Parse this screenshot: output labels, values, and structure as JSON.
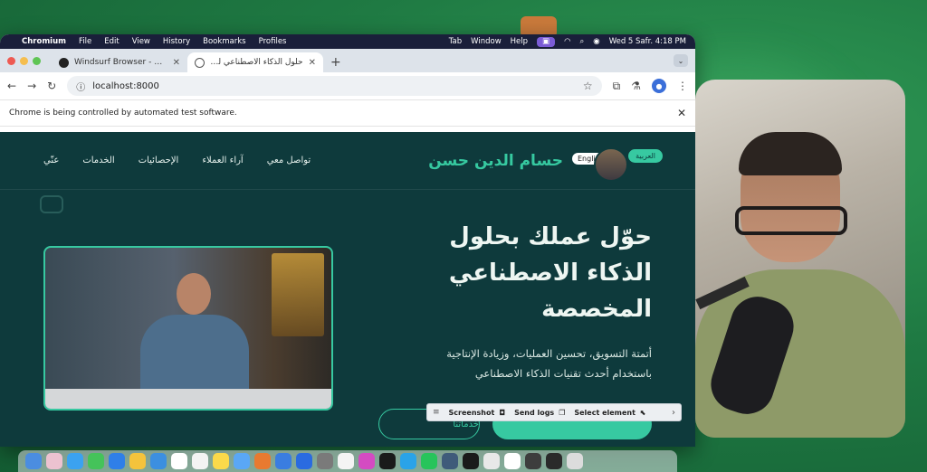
{
  "menubar": {
    "app": "Chromium",
    "items": [
      "File",
      "Edit",
      "View",
      "History",
      "Bookmarks",
      "Profiles"
    ],
    "right_items": [
      "Tab",
      "Window",
      "Help"
    ],
    "clock": "Wed 5 Safr.  4:18 PM"
  },
  "tabs": [
    {
      "title": "Windsurf Browser - Get start..."
    },
    {
      "title": "حلول الذكاء الاصطناعي للأعمال | حـ"
    }
  ],
  "address": {
    "url": "localhost:8000"
  },
  "infobar": {
    "message": "Chrome is being controlled by automated test software."
  },
  "site": {
    "brand": "حسام الدين حسن",
    "lang_en": "English",
    "lang_ar": "العربية",
    "nav": [
      "عنّي",
      "الخدمات",
      "الإحصائيات",
      "آراء العملاء",
      "تواصل معي"
    ],
    "hero_title": [
      "حوّل عملك بحلول",
      "الذكاء الاصطناعي",
      "المخصصة"
    ],
    "hero_sub": [
      "أتمتة التسويق، تحسين العمليات، وزيادة الإنتاجية",
      "باستخدام أحدث تقنيات الذكاء الاصطناعي"
    ],
    "btn_outline": "خدماتنا"
  },
  "devtools": {
    "screenshot": "Screenshot",
    "send_logs": "Send logs",
    "select_element": "Select element"
  },
  "colors": {
    "accent": "#37c9a1",
    "site_bg": "#0e3a3c",
    "desktop_green": "#1f7a43"
  }
}
